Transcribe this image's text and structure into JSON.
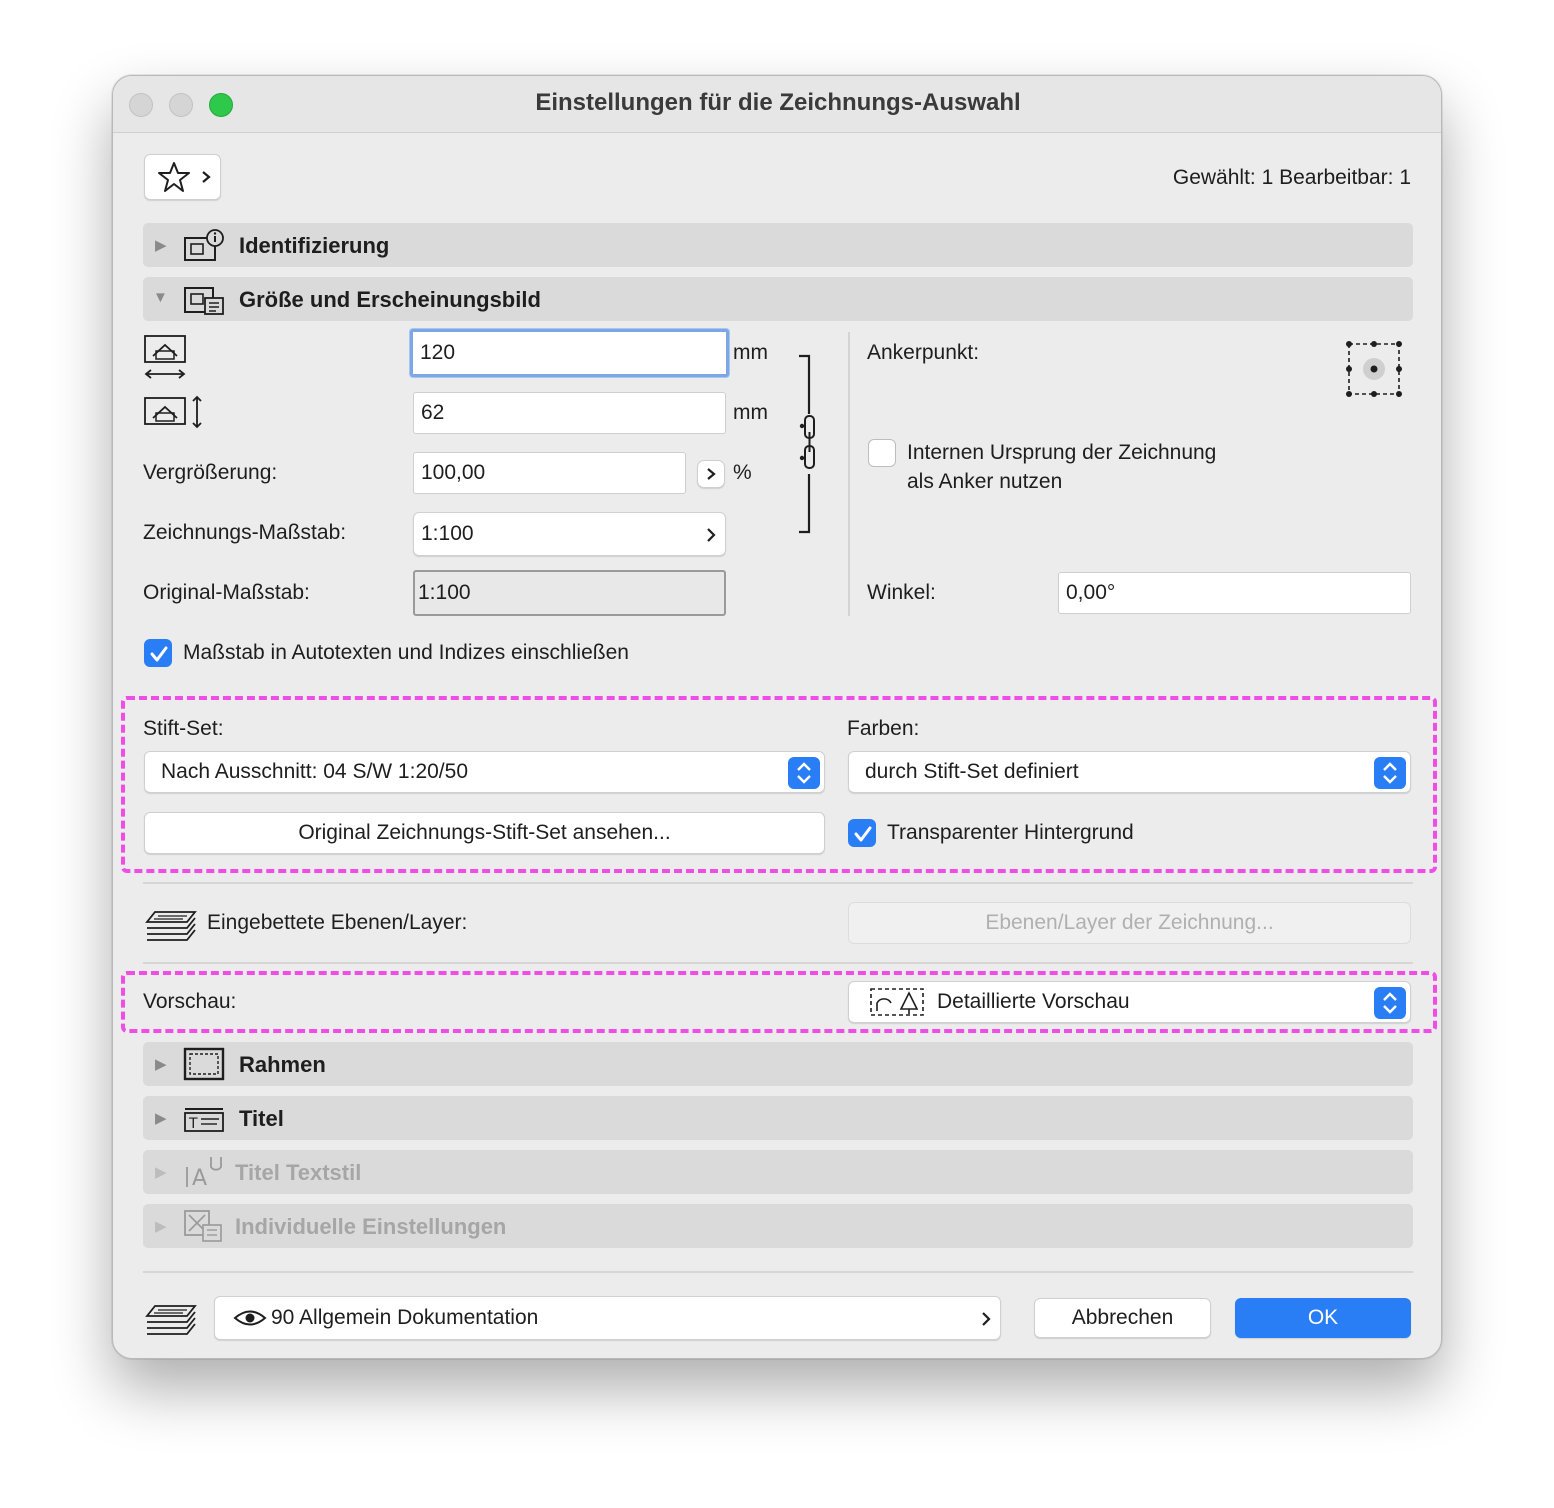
{
  "window": {
    "title": "Einstellungen für die Zeichnungs-Auswahl",
    "selection_info": "Gewählt: 1 Bearbeitbar: 1"
  },
  "sections": {
    "identification": "Identifizierung",
    "size_appearance": "Größe und Erscheinungsbild",
    "frame": "Rahmen",
    "title": "Titel",
    "title_text_style": "Titel Textstil",
    "custom_settings": "Individuelle Einstellungen"
  },
  "size": {
    "width_value": "120",
    "height_value": "62",
    "unit": "mm",
    "magnification_label": "Vergrößerung:",
    "magnification_value": "100,00",
    "percent": "%",
    "drawing_scale_label": "Zeichnungs-Maßstab:",
    "drawing_scale_value": "1:100",
    "original_scale_label": "Original-Maßstab:",
    "original_scale_value": "1:100",
    "anchor_label": "Ankerpunkt:",
    "internal_origin_line1": "Internen Ursprung der Zeichnung",
    "internal_origin_line2": "als Anker nutzen",
    "angle_label": "Winkel:",
    "angle_value": "0,00°",
    "include_scale_label": "Maßstab in Autotexten und Indizes einschließen"
  },
  "pen": {
    "penset_label": "Stift-Set:",
    "penset_value": "Nach Ausschnitt: 04 S/W 1:20/50",
    "colors_label": "Farben:",
    "colors_value": "durch Stift-Set definiert",
    "view_original_button": "Original Zeichnungs-Stift-Set ansehen...",
    "transparent_bg_label": "Transparenter Hintergrund"
  },
  "layers": {
    "embedded_label": "Eingebettete Ebenen/Layer:",
    "layers_button": "Ebenen/Layer der Zeichnung..."
  },
  "preview": {
    "label": "Vorschau:",
    "value": "Detaillierte Vorschau"
  },
  "footer": {
    "layer_value": "90 Allgemein Dokumentation",
    "cancel": "Abbrechen",
    "ok": "OK"
  },
  "colors": {
    "accent": "#2a7ef5",
    "highlight": "#f04ce6",
    "close": "#d5d5d5",
    "zoom": "#2ec84a"
  }
}
